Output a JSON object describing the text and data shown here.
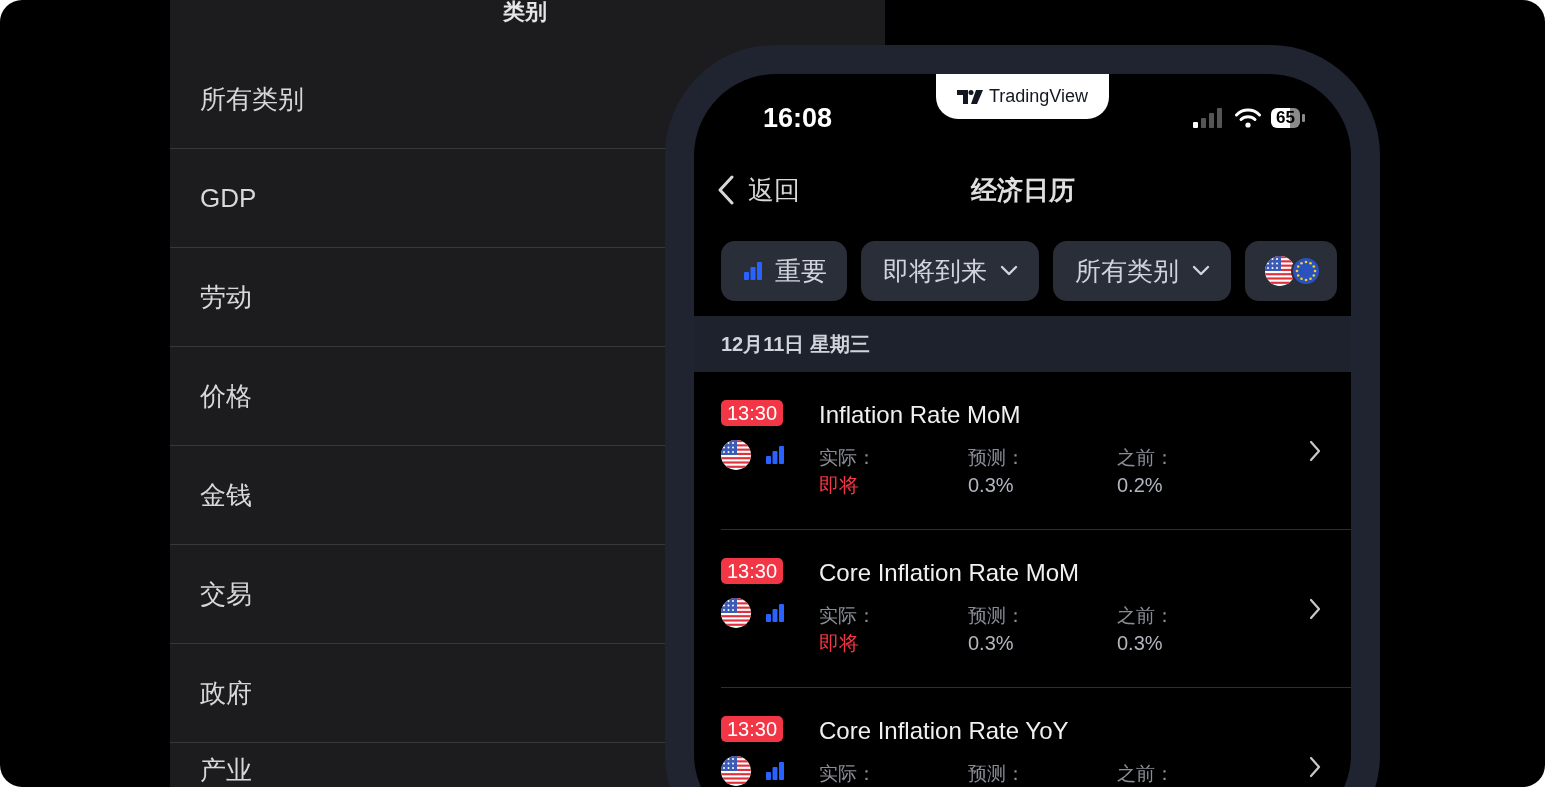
{
  "category_panel": {
    "title": "类别",
    "items": [
      "所有类别",
      "GDP",
      "劳动",
      "价格",
      "金钱",
      "交易",
      "政府",
      "产业"
    ]
  },
  "phone": {
    "notch": {
      "brand": "TradingView"
    },
    "status_bar": {
      "time": "16:08",
      "battery": "65"
    },
    "nav": {
      "back": "返回",
      "title": "经济日历"
    },
    "filters": [
      {
        "kind": "importance",
        "label": "重要"
      },
      {
        "kind": "dropdown",
        "label": "即将到来"
      },
      {
        "kind": "dropdown",
        "label": "所有类别"
      },
      {
        "kind": "countries"
      }
    ],
    "date_header": "12月11日 星期三",
    "events": [
      {
        "time": "13:30",
        "title": "Inflation Rate MoM",
        "fields": [
          {
            "label": "实际：",
            "value": "即将",
            "pending": true
          },
          {
            "label": "预测：",
            "value": "0.3%",
            "pending": false
          },
          {
            "label": "之前：",
            "value": "0.2%",
            "pending": false
          }
        ]
      },
      {
        "time": "13:30",
        "title": "Core Inflation Rate MoM",
        "fields": [
          {
            "label": "实际：",
            "value": "即将",
            "pending": true
          },
          {
            "label": "预测：",
            "value": "0.3%",
            "pending": false
          },
          {
            "label": "之前：",
            "value": "0.3%",
            "pending": false
          }
        ]
      },
      {
        "time": "13:30",
        "title": "Core Inflation Rate YoY",
        "fields": [
          {
            "label": "实际："
          },
          {
            "label": "预测："
          },
          {
            "label": "之前："
          }
        ]
      }
    ]
  }
}
